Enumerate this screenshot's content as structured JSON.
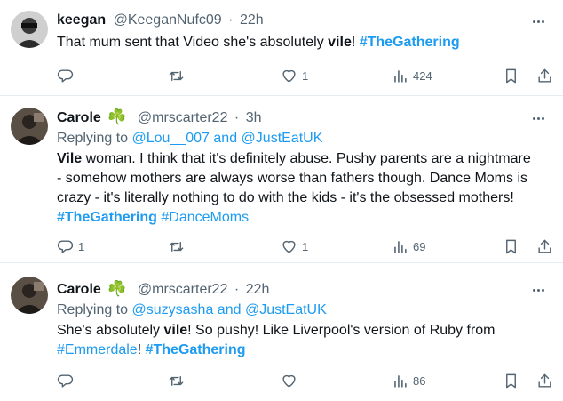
{
  "tweets": [
    {
      "name": "keegan",
      "handle": "@KeeganNufc09",
      "dot": "·",
      "time": "22h",
      "text_pre": "That mum sent that Video she's absolutely ",
      "text_bold": "vile",
      "text_post": "! ",
      "hashtag": "#TheGathering",
      "stats": {
        "replies": "",
        "retweets": "",
        "likes": "1",
        "views": "424"
      }
    },
    {
      "name": "Carole",
      "shamrock": "☘️",
      "handle": "@mrscarter22",
      "dot": "·",
      "time": "3h",
      "replying_label": "Replying to",
      "replying_user1": "@Lou__007",
      "replying_and": "and",
      "replying_user2": "@JustEatUK",
      "text_bold": "Vile",
      "text_line1": " woman. I think that it's definitely abuse. Pushy parents are a nightmare",
      "text_line2": "- somehow mothers are always worse than fathers though. Dance Moms is",
      "text_line3": "crazy - it's literally nothing to do with the kids - it's the obsessed mothers!",
      "hashtag1": "#TheGathering",
      "hashtag2": "#DanceMoms",
      "stats": {
        "replies": "1",
        "retweets": "",
        "likes": "1",
        "views": "69"
      }
    },
    {
      "name": "Carole",
      "shamrock": "☘️",
      "handle": "@mrscarter22",
      "dot": "·",
      "time": "22h",
      "replying_label": "Replying to",
      "replying_user1": "@suzysasha",
      "replying_and": "and",
      "replying_user2": "@JustEatUK",
      "text_pre": "She's absolutely ",
      "text_bold": "vile",
      "text_post": "! So pushy! Like Liverpool's version of Ruby from",
      "hashtag1": "#Emmerdale",
      "text_after_tag": "! ",
      "hashtag2": "#TheGathering",
      "stats": {
        "replies": "",
        "retweets": "",
        "likes": "",
        "views": "86"
      }
    }
  ],
  "colors": {
    "link": "#1d9bf0",
    "secondary": "#536471",
    "text": "#0f1419",
    "divider": "#e6ecf0"
  }
}
